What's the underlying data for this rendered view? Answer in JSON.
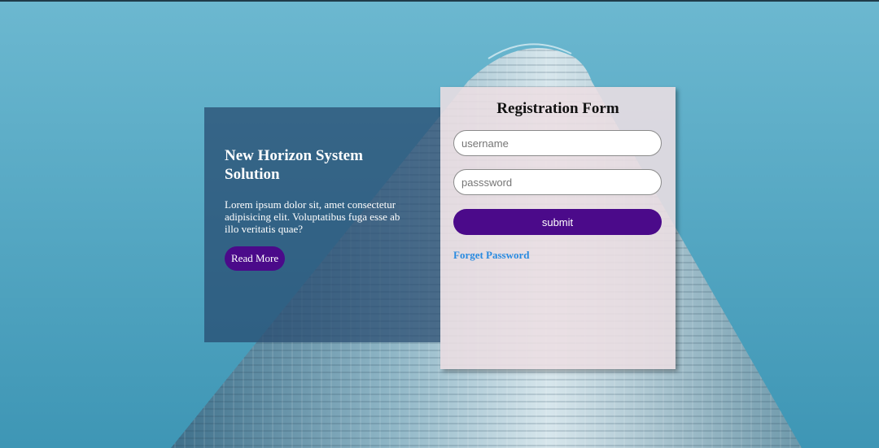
{
  "colors": {
    "sky": "#4aa3c2",
    "info_panel": "#26486e",
    "form_panel": "#ecdee2",
    "accent_purple": "#4b0a8a",
    "link_blue": "#2a8be0"
  },
  "background": {
    "image": "skyscraper-against-blue-sky"
  },
  "info_panel": {
    "title": "New Horizon System Solution",
    "body": "Lorem ipsum dolor sit, amet consectetur adipisicing elit. Voluptatibus fuga esse ab illo veritatis quae?",
    "button_label": "Read More"
  },
  "form": {
    "title": "Registration Form",
    "username": {
      "value": "",
      "placeholder": "username"
    },
    "password": {
      "value": "",
      "placeholder": "passsword"
    },
    "submit_label": "submit",
    "forget_label": "Forget Password"
  }
}
